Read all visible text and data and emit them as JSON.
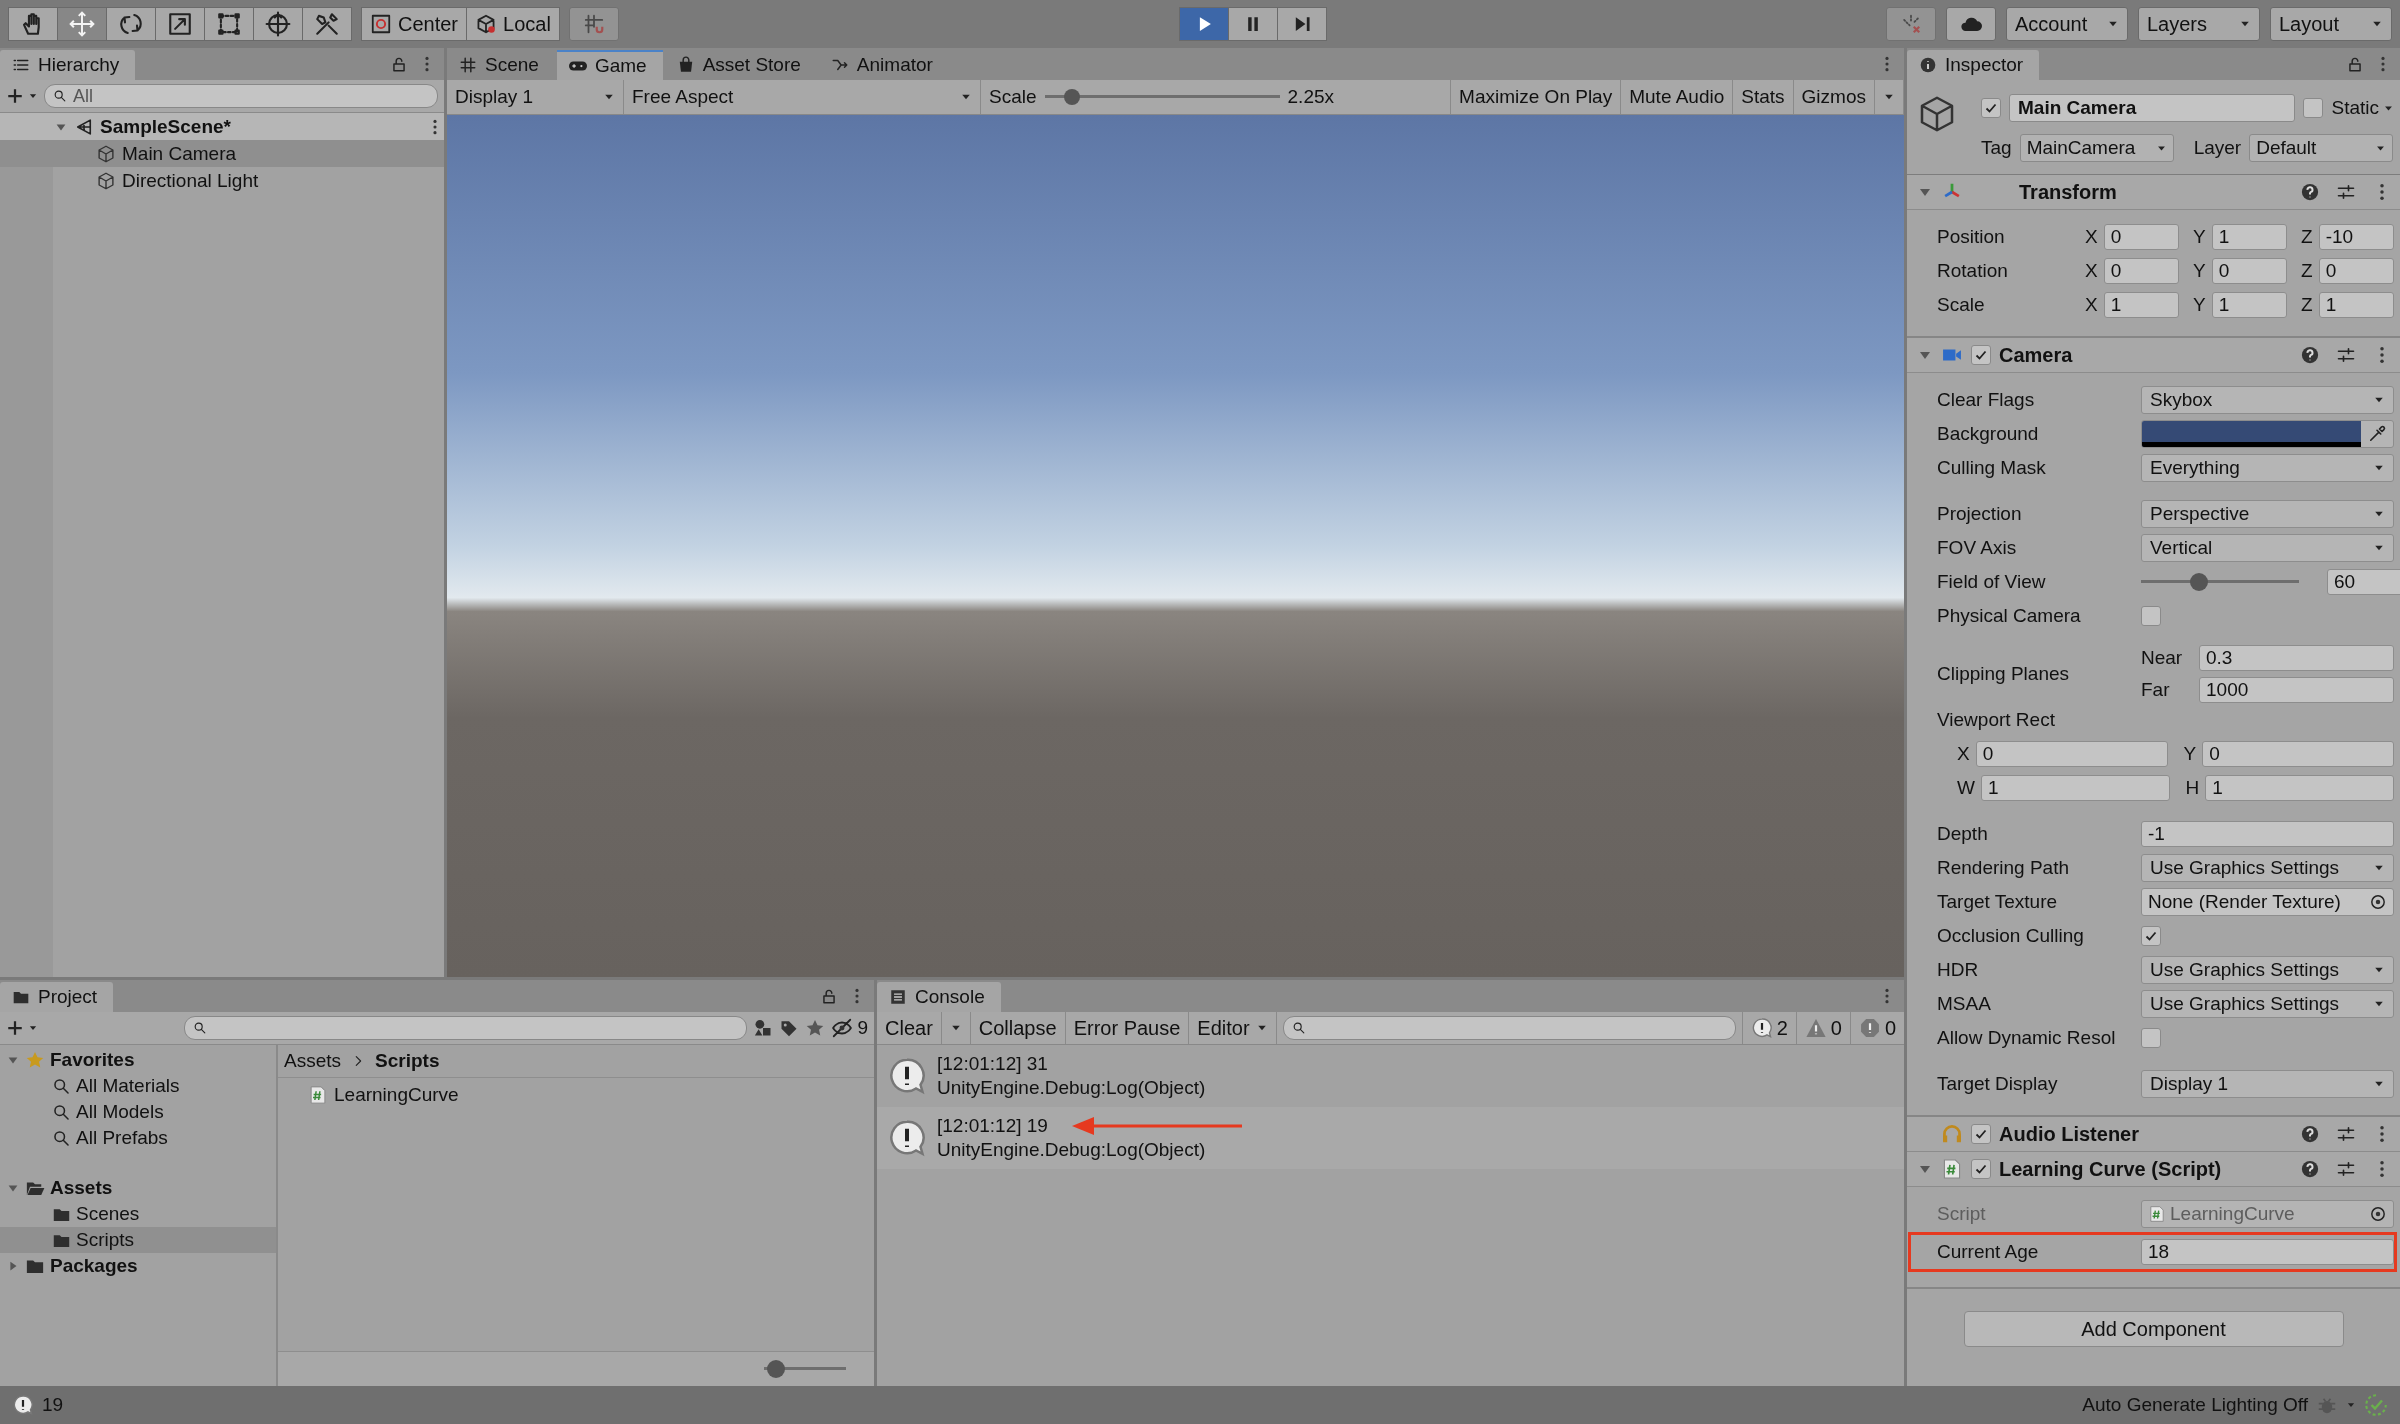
{
  "toolbar": {
    "tools": [
      {
        "kind": "hand",
        "selected": false
      },
      {
        "kind": "move",
        "selected": true
      },
      {
        "kind": "rotate",
        "selected": false
      },
      {
        "kind": "scale",
        "selected": false
      },
      {
        "kind": "rect",
        "selected": false
      },
      {
        "kind": "transform",
        "selected": false
      },
      {
        "kind": "custom",
        "selected": false
      }
    ],
    "pivot": [
      {
        "kind": "center",
        "label": "Center"
      },
      {
        "kind": "local",
        "label": "Local"
      }
    ],
    "grid_snap": {
      "disabled": true
    },
    "playback": [
      {
        "kind": "play",
        "selected": true
      },
      {
        "kind": "pause",
        "selected": false
      },
      {
        "kind": "step",
        "selected": false
      }
    ],
    "menus": [
      {
        "label": "Account"
      },
      {
        "label": "Layers"
      },
      {
        "label": "Layout"
      }
    ]
  },
  "hierarchy": {
    "title": "Hierarchy",
    "search": {
      "placeholder": "All"
    },
    "tree": [
      {
        "kind": "scene",
        "label": "SampleScene*",
        "expanded": true,
        "selected": false,
        "children": [
          {
            "kind": "object",
            "label": "Main Camera",
            "selected": true
          },
          {
            "kind": "object",
            "label": "Directional Light",
            "selected": false
          }
        ]
      }
    ]
  },
  "game": {
    "tabs": [
      {
        "kind": "scene",
        "label": "Scene",
        "selected": false
      },
      {
        "kind": "game",
        "label": "Game",
        "selected": true
      },
      {
        "kind": "store",
        "label": "Asset Store",
        "selected": false
      },
      {
        "kind": "animator",
        "label": "Animator",
        "selected": false
      }
    ],
    "display": "Display 1",
    "aspect": "Free Aspect",
    "scale": {
      "label": "Scale",
      "level": 0.09,
      "reading": "2.25x"
    },
    "toggles": [
      {
        "label": "Maximize On Play",
        "on": false
      },
      {
        "label": "Mute Audio",
        "on": false
      },
      {
        "label": "Stats",
        "on": false
      }
    ],
    "gizmos": "Gizmos"
  },
  "inspector": {
    "title": "Inspector",
    "object": {
      "active": true,
      "name": "Main Camera",
      "static": false,
      "static_label": "Static",
      "tag_label": "Tag",
      "tag": "MainCamera",
      "layer_label": "Layer",
      "layer": "Default"
    },
    "components": [
      {
        "kind": "transform",
        "title": "Transform",
        "expanded": true,
        "groups": [
          [
            {
              "kind": "vector3",
              "label": "Position",
              "fields": [
                {
                  "axis": "X",
                  "value": "0"
                },
                {
                  "axis": "Y",
                  "value": "1"
                },
                {
                  "axis": "Z",
                  "value": "-10"
                }
              ]
            },
            {
              "kind": "vector3",
              "label": "Rotation",
              "fields": [
                {
                  "axis": "X",
                  "value": "0"
                },
                {
                  "axis": "Y",
                  "value": "0"
                },
                {
                  "axis": "Z",
                  "value": "0"
                }
              ]
            },
            {
              "kind": "vector3",
              "label": "Scale",
              "fields": [
                {
                  "axis": "X",
                  "value": "1"
                },
                {
                  "axis": "Y",
                  "value": "1"
                },
                {
                  "axis": "Z",
                  "value": "1"
                }
              ]
            }
          ]
        ]
      },
      {
        "kind": "camera",
        "title": "Camera",
        "expanded": true,
        "enabled": true,
        "groups": [
          [
            {
              "kind": "dropdown",
              "label": "Clear Flags",
              "value": "Skybox"
            },
            {
              "kind": "color",
              "label": "Background",
              "color": "#354a75"
            },
            {
              "kind": "dropdown",
              "label": "Culling Mask",
              "value": "Everything"
            }
          ],
          [
            {
              "kind": "dropdown",
              "label": "Projection",
              "value": "Perspective"
            },
            {
              "kind": "dropdown",
              "label": "FOV Axis",
              "value": "Vertical"
            },
            {
              "kind": "slider",
              "label": "Field of View",
              "level": 0.35,
              "value": "60"
            },
            {
              "kind": "checkbox",
              "label": "Physical Camera",
              "checked": false
            }
          ],
          [
            {
              "kind": "pair",
              "label": "Clipping Planes",
              "fields": [
                {
                  "axis": "Near",
                  "value": "0.3"
                },
                {
                  "axis": "Far",
                  "value": "1000"
                }
              ]
            },
            {
              "kind": "heading",
              "label": "Viewport Rect"
            },
            {
              "kind": "vector2",
              "fields": [
                {
                  "axis": "X",
                  "value": "0"
                },
                {
                  "axis": "Y",
                  "value": "0"
                }
              ]
            },
            {
              "kind": "vector2",
              "fields": [
                {
                  "axis": "W",
                  "value": "1"
                },
                {
                  "axis": "H",
                  "value": "1"
                }
              ]
            }
          ],
          [
            {
              "kind": "text",
              "label": "Depth",
              "value": "-1"
            },
            {
              "kind": "dropdown",
              "label": "Rendering Path",
              "value": "Use Graphics Settings"
            },
            {
              "kind": "object",
              "label": "Target Texture",
              "value": "None (Render Texture)",
              "disabled": false
            },
            {
              "kind": "checkbox",
              "label": "Occlusion Culling",
              "checked": true
            },
            {
              "kind": "dropdown",
              "label": "HDR",
              "value": "Use Graphics Settings"
            },
            {
              "kind": "dropdown",
              "label": "MSAA",
              "value": "Use Graphics Settings"
            },
            {
              "kind": "checkbox",
              "label": "Allow Dynamic Resol",
              "checked": false
            }
          ],
          [
            {
              "kind": "dropdown",
              "label": "Target Display",
              "value": "Display 1"
            }
          ]
        ]
      },
      {
        "kind": "audio",
        "title": "Audio Listener",
        "enabled": true
      },
      {
        "kind": "script",
        "title": "Learning Curve (Script)",
        "expanded": true,
        "enabled": true,
        "groups": [
          [
            {
              "kind": "object",
              "label": "Script",
              "value": "LearningCurve",
              "disabled": true,
              "script": true
            },
            {
              "kind": "text",
              "label": "Current Age",
              "value": "18",
              "highlighted": true
            }
          ]
        ]
      }
    ],
    "add_button": "Add Component"
  },
  "project": {
    "title": "Project",
    "hidden_count": "9",
    "tree": [
      {
        "kind": "favorites",
        "label": "Favorites",
        "expanded": true,
        "selected": false,
        "children": [
          {
            "kind": "search",
            "label": "All Materials",
            "selected": false
          },
          {
            "kind": "search",
            "label": "All Models",
            "selected": false
          },
          {
            "kind": "search",
            "label": "All Prefabs",
            "selected": false
          }
        ]
      },
      {
        "kind": "folder",
        "label": "Assets",
        "expanded": true,
        "selected": false,
        "children": [
          {
            "kind": "folder",
            "label": "Scenes",
            "selected": false
          },
          {
            "kind": "folder",
            "label": "Scripts",
            "selected": true
          }
        ]
      },
      {
        "kind": "folder",
        "label": "Packages",
        "expanded": false,
        "selected": false
      }
    ],
    "breadcrumb": [
      "Assets",
      "Scripts"
    ],
    "files": [
      {
        "kind": "script",
        "label": "LearningCurve"
      }
    ],
    "icon_size": {
      "level": 0.05
    }
  },
  "console": {
    "title": "Console",
    "buttons": [
      {
        "kind": "split",
        "label": "Clear"
      },
      {
        "kind": "plain",
        "label": "Collapse"
      },
      {
        "kind": "plain",
        "label": "Error Pause"
      },
      {
        "kind": "dropdown",
        "label": "Editor"
      }
    ],
    "counts": [
      {
        "kind": "info",
        "value": "2"
      },
      {
        "kind": "warning",
        "value": "0"
      },
      {
        "kind": "error",
        "value": "0"
      }
    ],
    "entries": [
      {
        "kind": "info",
        "lines": [
          "[12:01:12] 31",
          "UnityEngine.Debug:Log(Object)"
        ],
        "annotated": false
      },
      {
        "kind": "info",
        "lines": [
          "[12:01:12] 19",
          "UnityEngine.Debug:Log(Object)"
        ],
        "annotated": true
      }
    ]
  },
  "status_bar": {
    "message": "19",
    "lighting": "Auto Generate Lighting Off"
  }
}
